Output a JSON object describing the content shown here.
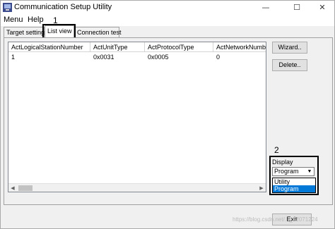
{
  "window": {
    "title": "Communication Setup Utility",
    "controls": [
      "—",
      "☐",
      "✕"
    ]
  },
  "menubar": {
    "items": [
      "Menu",
      "Help"
    ]
  },
  "tabs": [
    {
      "label": "Target setting"
    },
    {
      "label": "List view"
    },
    {
      "label": "Connection test"
    }
  ],
  "list": {
    "columns": [
      "ActLogicalStationNumber",
      "ActUnitType",
      "ActProtocolType",
      "ActNetworkNumber"
    ],
    "rows": [
      [
        "1",
        "0x0031",
        "0x0005",
        "0"
      ]
    ]
  },
  "buttons": {
    "wizard": "Wizard..",
    "delete": "Delete..",
    "exit": "Exit"
  },
  "display": {
    "label": "Display",
    "selected": "Program",
    "options": [
      "Utility",
      "Program"
    ]
  },
  "annotations": {
    "one": "1",
    "two": "2"
  },
  "watermark": "https://blog.csdn.net/..._52071224",
  "colors": {
    "highlight": "#0078d7",
    "window_bg": "#f0f0f0",
    "button_bg": "#e1e1e1"
  }
}
